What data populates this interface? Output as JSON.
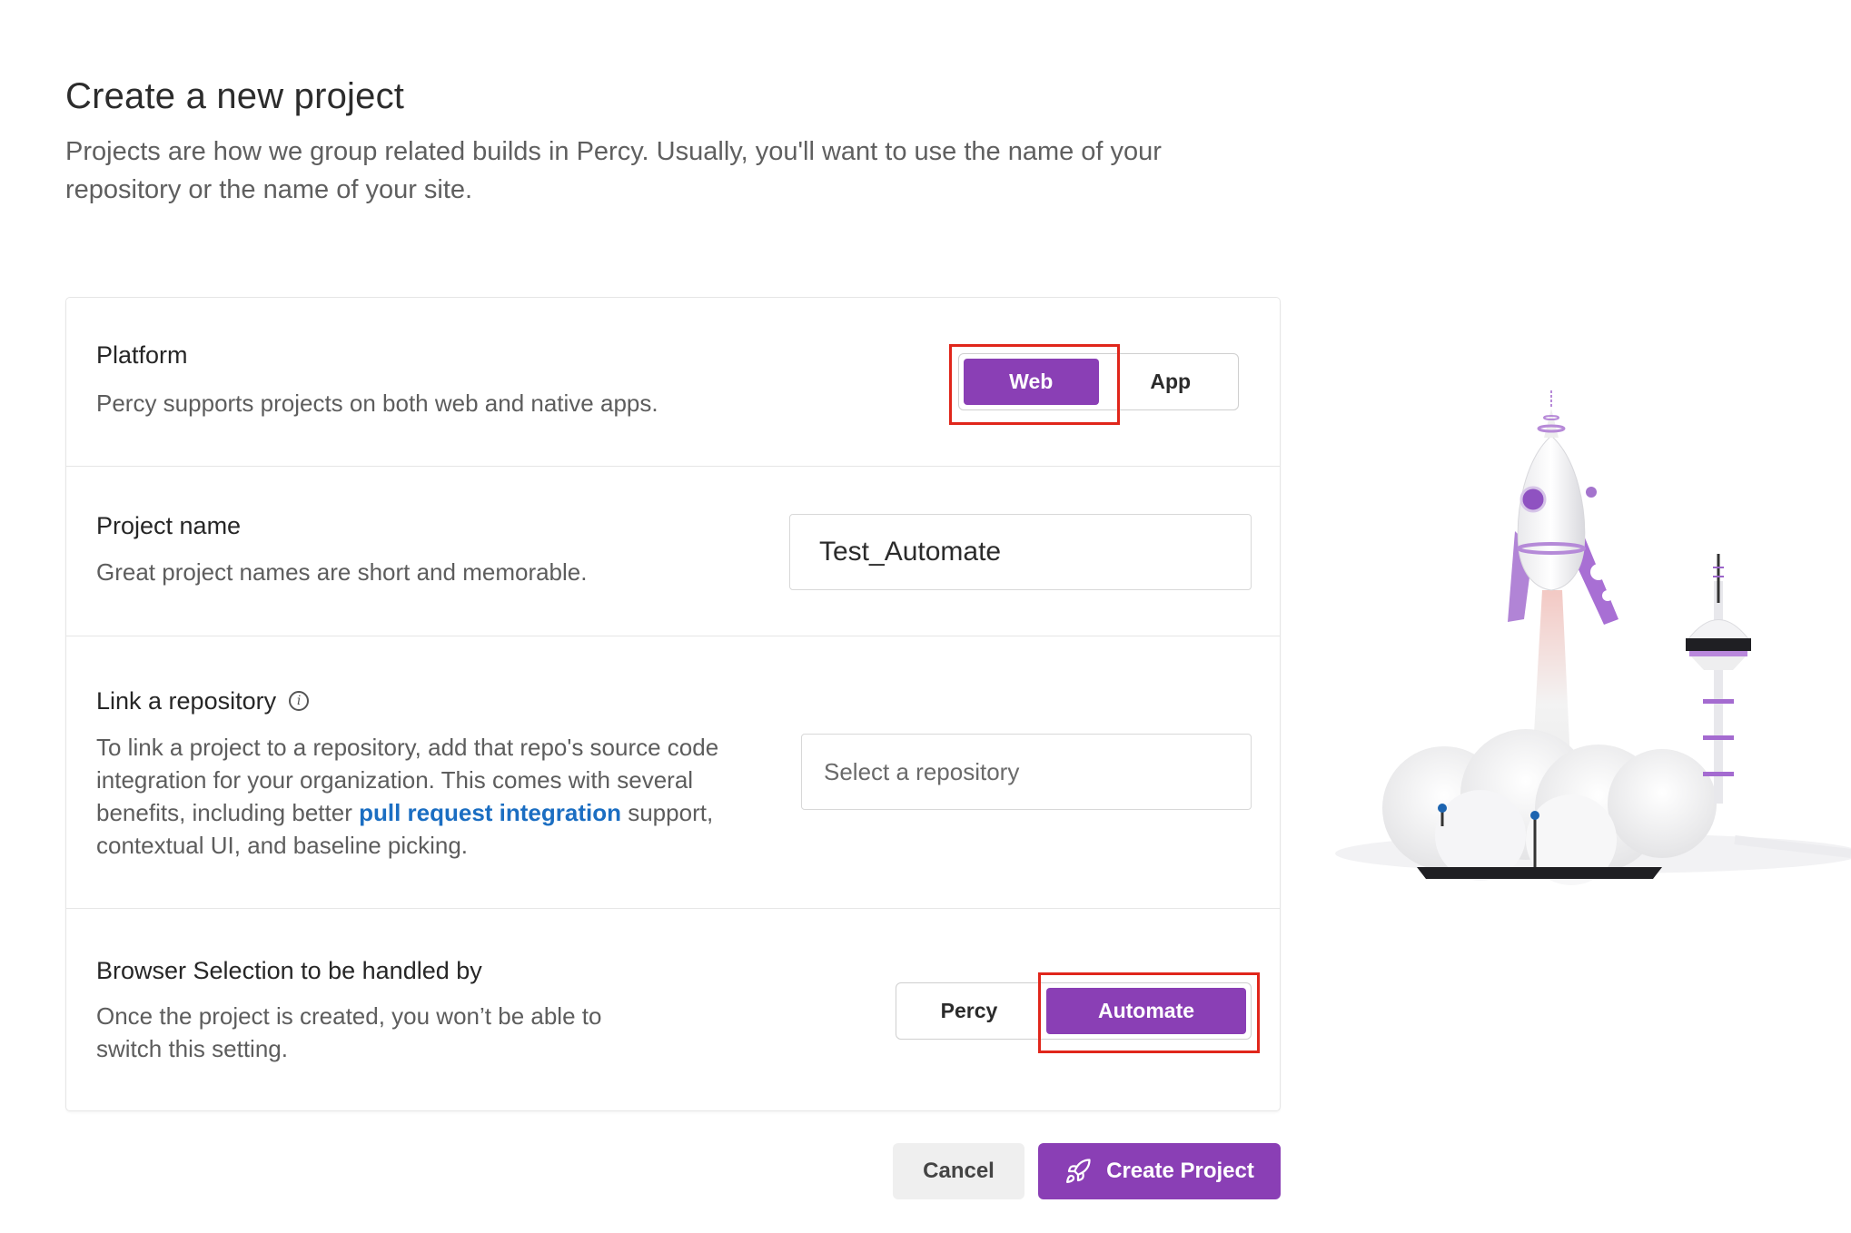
{
  "header": {
    "title": "Create a new project",
    "subtitle": "Projects are how we group related builds in Percy. Usually, you'll want to use the name of your repository or the name of your site."
  },
  "platform": {
    "title": "Platform",
    "description": "Percy supports projects on both web and native apps.",
    "options": [
      "Web",
      "App"
    ],
    "selected": "Web"
  },
  "project_name": {
    "title": "Project name",
    "description": "Great project names are short and memorable.",
    "value": "Test_Automate"
  },
  "repository": {
    "title": "Link a repository",
    "description_before": "To link a project to a repository, add that repo's source code integration for your organization. This comes with several benefits, including better ",
    "link_text": "pull request integration",
    "description_after": " support, contextual UI, and baseline picking.",
    "placeholder": "Select a repository",
    "info_icon": "info-icon"
  },
  "browser_selection": {
    "title": "Browser Selection to be handled by",
    "description": "Once the project is created, you won’t be able to switch this setting.",
    "options": [
      "Percy",
      "Automate"
    ],
    "selected": "Automate"
  },
  "footer": {
    "cancel_label": "Cancel",
    "create_label": "Create Project",
    "create_icon": "rocket-icon"
  },
  "colors": {
    "accent": "#8a3fb5",
    "highlight": "#e0261b",
    "link": "#1b6ec2"
  }
}
